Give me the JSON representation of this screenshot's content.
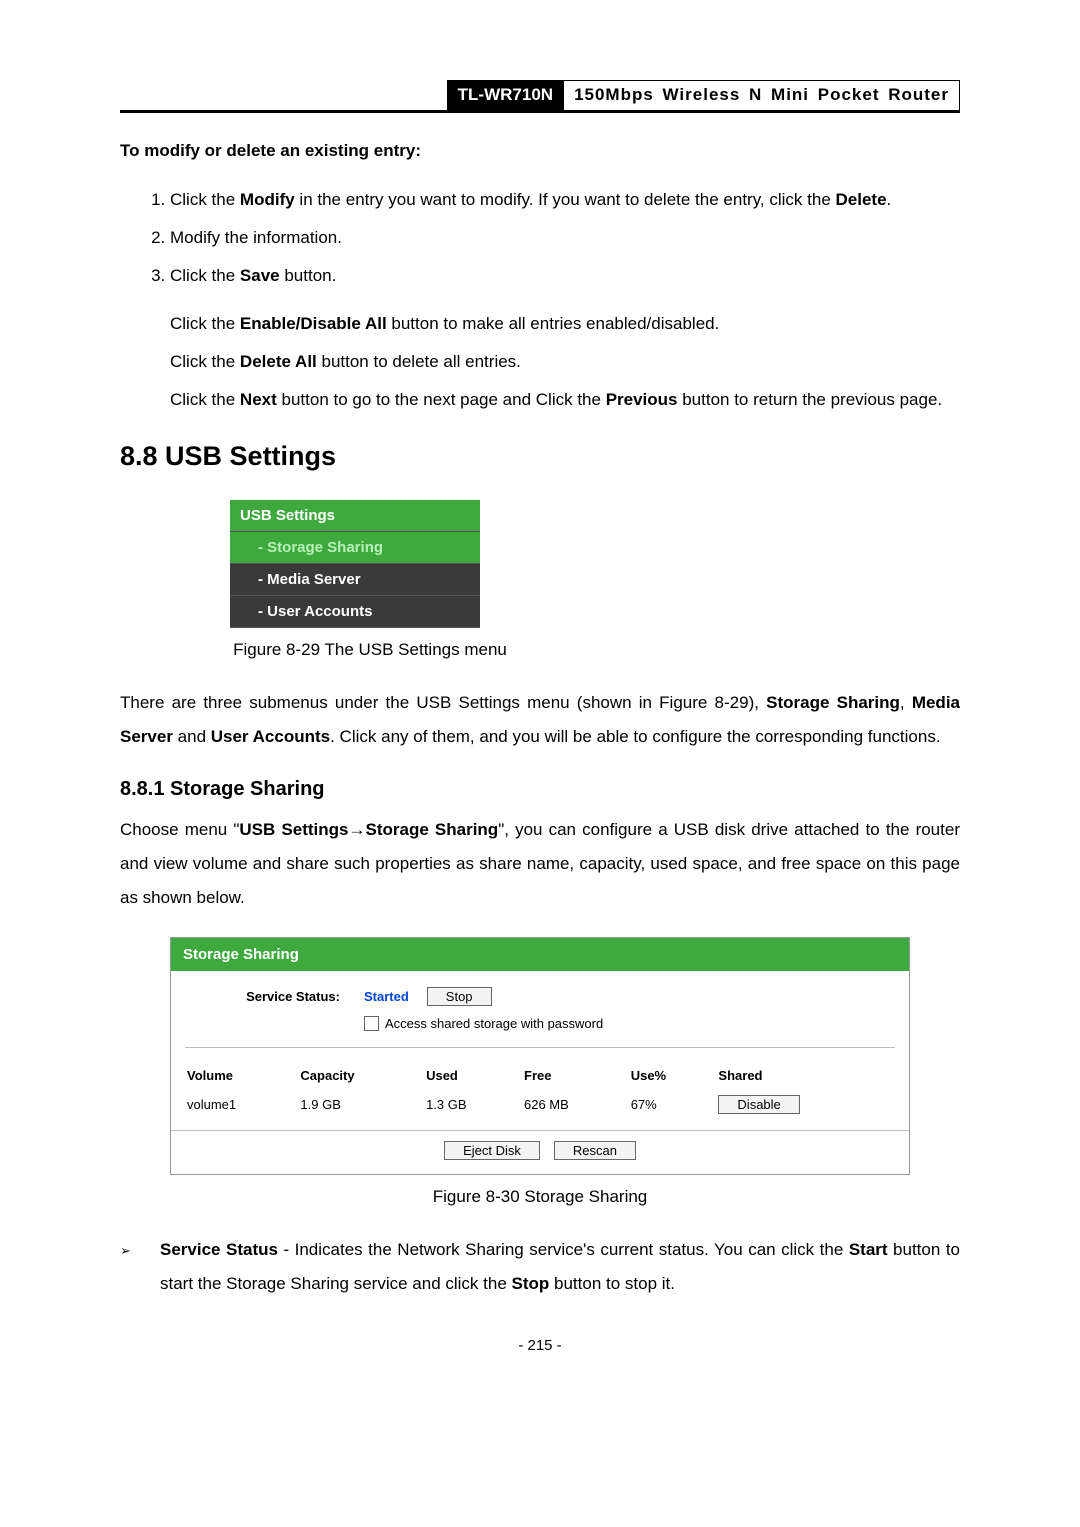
{
  "header": {
    "model": "TL-WR710N",
    "desc": "150Mbps Wireless N Mini Pocket Router"
  },
  "modify_delete": {
    "title": "To modify or delete an existing entry:",
    "step1_a": "Click the ",
    "step1_b": "Modify",
    "step1_c": " in the entry you want to modify. If you want to delete the entry, click the ",
    "step1_d": "Delete",
    "step1_e": ".",
    "step2": "Modify the information.",
    "step3_a": "Click the ",
    "step3_b": "Save",
    "step3_c": " button."
  },
  "notes": {
    "n1_a": "Click the ",
    "n1_b": "Enable/Disable All",
    "n1_c": " button to make all entries enabled/disabled.",
    "n2_a": "Click the ",
    "n2_b": "Delete All",
    "n2_c": " button to delete all entries.",
    "n3_a": "Click the ",
    "n3_b": "Next",
    "n3_c": " button to go to the next page and Click the ",
    "n3_d": "Previous",
    "n3_e": " button to return the previous page."
  },
  "section": {
    "title": "8.8  USB Settings"
  },
  "menu": {
    "header": "USB Settings",
    "items": [
      {
        "label": "- Storage Sharing",
        "active": true
      },
      {
        "label": "- Media Server",
        "active": false
      },
      {
        "label": "- User Accounts",
        "active": false
      }
    ],
    "caption": "Figure 8-29 The USB Settings menu"
  },
  "usb_intro": {
    "t1": "There are three submenus under the USB Settings menu (shown in Figure 8-29), ",
    "b1": "Storage Sharing",
    "t2": ", ",
    "b2": "Media Server",
    "t3": " and ",
    "b3": "User Accounts",
    "t4": ". Click any of them, and you will be able to configure the corresponding functions."
  },
  "subsection": {
    "title": "8.8.1  Storage Sharing",
    "p1_a": "Choose menu \"",
    "p1_b": "USB Settings→Storage Sharing",
    "p1_c": "\", you can configure a USB disk drive attached to the router and view volume and share such properties as share name, capacity, used space, and free space on this page as shown below."
  },
  "storage_panel": {
    "title": "Storage Sharing",
    "service_label": "Service Status:",
    "service_value": "Started",
    "stop_btn": "Stop",
    "check_label": "Access shared storage with password",
    "columns": {
      "c1": "Volume",
      "c2": "Capacity",
      "c3": "Used",
      "c4": "Free",
      "c5": "Use%",
      "c6": "Shared"
    },
    "row": {
      "volume": "volume1",
      "capacity": "1.9 GB",
      "used": "1.3 GB",
      "free": "626 MB",
      "usep": "67%",
      "shared_btn": "Disable"
    },
    "eject_btn": "Eject Disk",
    "rescan_btn": "Rescan",
    "caption": "Figure 8-30 Storage Sharing"
  },
  "defs": {
    "d1_b": "Service Status",
    "d1_t1": " - Indicates the Network Sharing service's current status. You can click the ",
    "d1_b2": "Start",
    "d1_t2": " button to start the Storage Sharing service and click the ",
    "d1_b3": "Stop",
    "d1_t3": " button to stop it."
  },
  "page_number": "- 215 -"
}
